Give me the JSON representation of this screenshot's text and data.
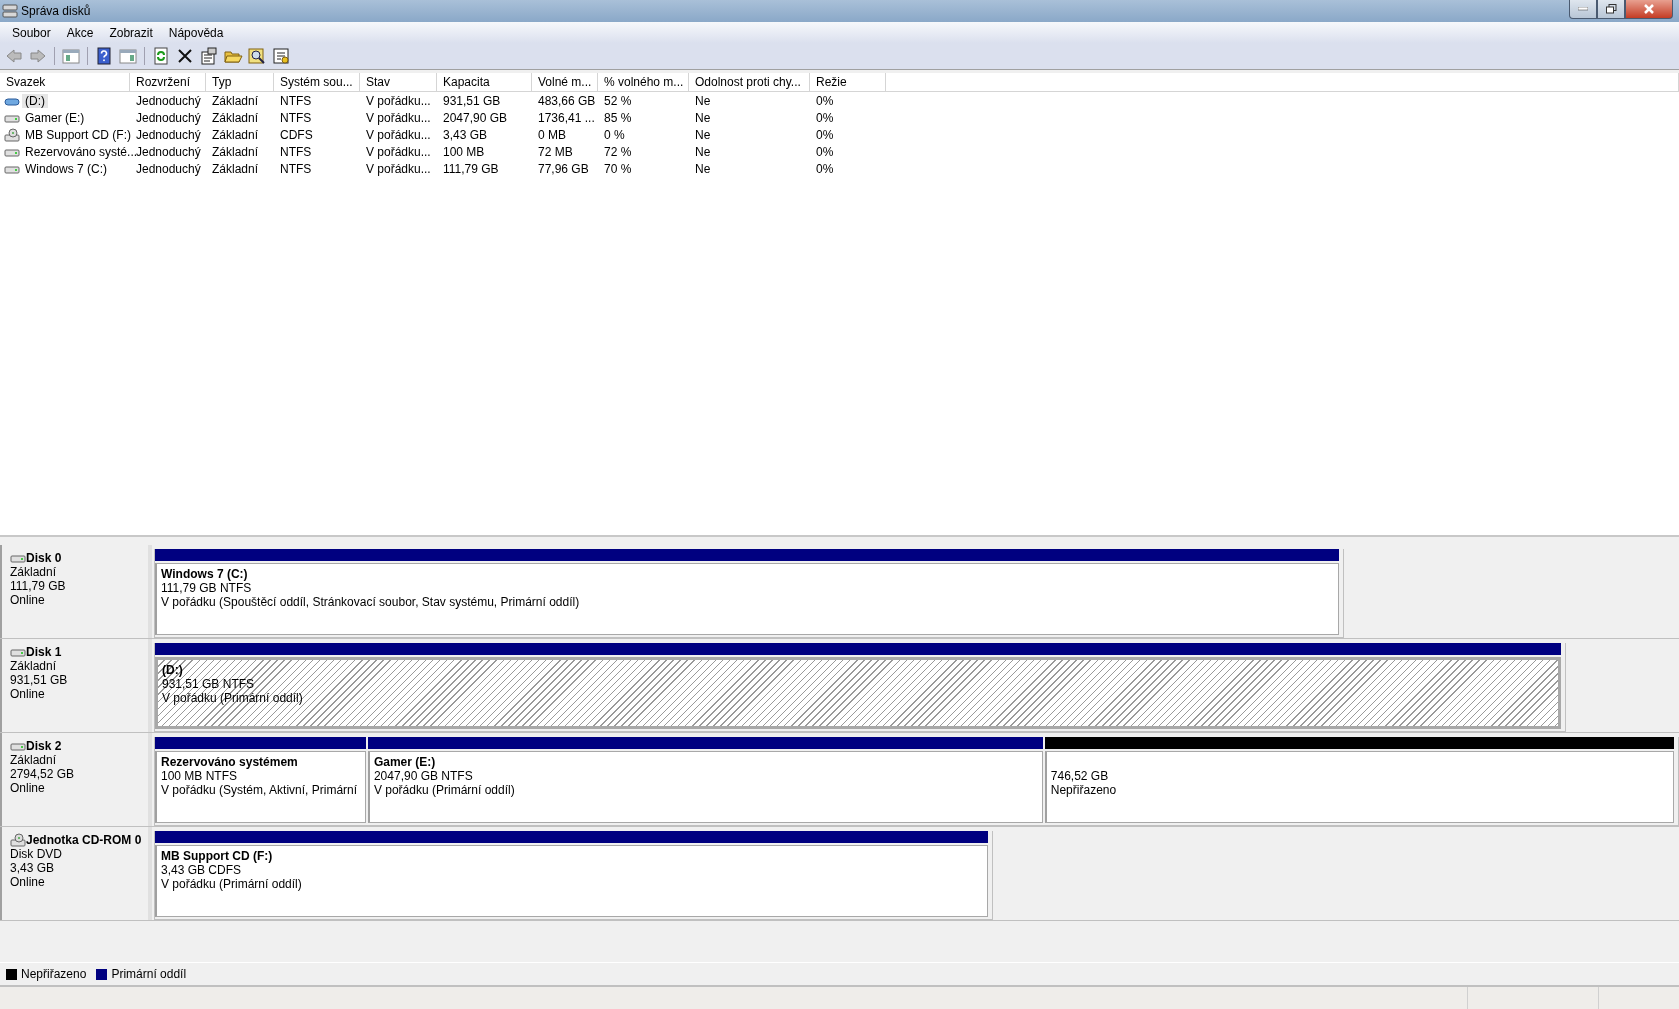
{
  "window": {
    "title": "Správa disků"
  },
  "menu": [
    "Soubor",
    "Akce",
    "Zobrazit",
    "Nápověda"
  ],
  "table": {
    "columns": [
      "Svazek",
      "Rozvržení",
      "Typ",
      "Systém sou...",
      "Stav",
      "Kapacita",
      "Volné m...",
      "% volného m...",
      "Odolnost proti chy...",
      "Režie"
    ],
    "rows": [
      {
        "kind": "blue-disk",
        "selected": true,
        "cells": [
          "(D:)",
          "Jednoduchý",
          "Základní",
          "NTFS",
          "V pořádku...",
          "931,51 GB",
          "483,66 GB",
          "52 %",
          "Ne",
          "0%"
        ]
      },
      {
        "kind": "disk",
        "selected": false,
        "cells": [
          "Gamer (E:)",
          "Jednoduchý",
          "Základní",
          "NTFS",
          "V pořádku...",
          "2047,90 GB",
          "1736,41 ...",
          "85 %",
          "Ne",
          "0%"
        ]
      },
      {
        "kind": "cd",
        "selected": false,
        "cells": [
          "MB Support CD (F:)",
          "Jednoduchý",
          "Základní",
          "CDFS",
          "V pořádku...",
          "3,43 GB",
          "0 MB",
          "0 %",
          "Ne",
          "0%"
        ]
      },
      {
        "kind": "disk",
        "selected": false,
        "cells": [
          "Rezervováno systé...",
          "Jednoduchý",
          "Základní",
          "NTFS",
          "V pořádku...",
          "100 MB",
          "72 MB",
          "72 %",
          "Ne",
          "0%"
        ]
      },
      {
        "kind": "disk",
        "selected": false,
        "cells": [
          "Windows 7 (C:)",
          "Jednoduchý",
          "Základní",
          "NTFS",
          "V pořádku...",
          "111,79 GB",
          "77,96 GB",
          "70 %",
          "Ne",
          "0%"
        ]
      }
    ]
  },
  "disks": [
    {
      "kind": "hdd",
      "name": "Disk 0",
      "type": "Základní",
      "size": "111,79 GB",
      "status": "Online",
      "partitions": [
        {
          "name": "Windows 7  (C:)",
          "size": "111,79 GB NTFS",
          "status": "V pořádku (Spouštěcí oddíl, Stránkovací soubor, Stav systému, Primární oddíl)",
          "color": "#000080",
          "selected": false
        }
      ]
    },
    {
      "kind": "hdd",
      "name": "Disk 1",
      "type": "Základní",
      "size": "931,51 GB",
      "status": "Online",
      "partitions": [
        {
          "name": "(D:)",
          "size": "931,51 GB NTFS",
          "status": "V pořádku (Primární oddíl)",
          "color": "#000080",
          "selected": true
        }
      ]
    },
    {
      "kind": "hdd",
      "name": "Disk 2",
      "type": "Základní",
      "size": "2794,52 GB",
      "status": "Online",
      "partitions": [
        {
          "name": "Rezervováno systémem",
          "size": "100 MB NTFS",
          "status": "V pořádku (Systém, Aktivní, Primární",
          "color": "#000080",
          "selected": false
        },
        {
          "name": "Gamer  (E:)",
          "size": "2047,90 GB NTFS",
          "status": "V pořádku (Primární oddíl)",
          "color": "#000080",
          "selected": false
        },
        {
          "size": "746,52 GB",
          "status": "Nepřiřazeno",
          "color": "#000000",
          "selected": false
        }
      ]
    },
    {
      "kind": "cd",
      "name": "Jednotka CD-ROM 0",
      "type": "Disk DVD",
      "size": "3,43 GB",
      "status": "Online",
      "partitions": [
        {
          "name": "MB Support CD  (F:)",
          "size": "3,43 GB CDFS",
          "status": "V pořádku (Primární oddíl)",
          "color": "#000080",
          "selected": false
        }
      ]
    }
  ],
  "legend": [
    {
      "label": "Nepřiřazeno",
      "color": "#000000"
    },
    {
      "label": "Primární oddíl",
      "color": "#000080"
    }
  ]
}
